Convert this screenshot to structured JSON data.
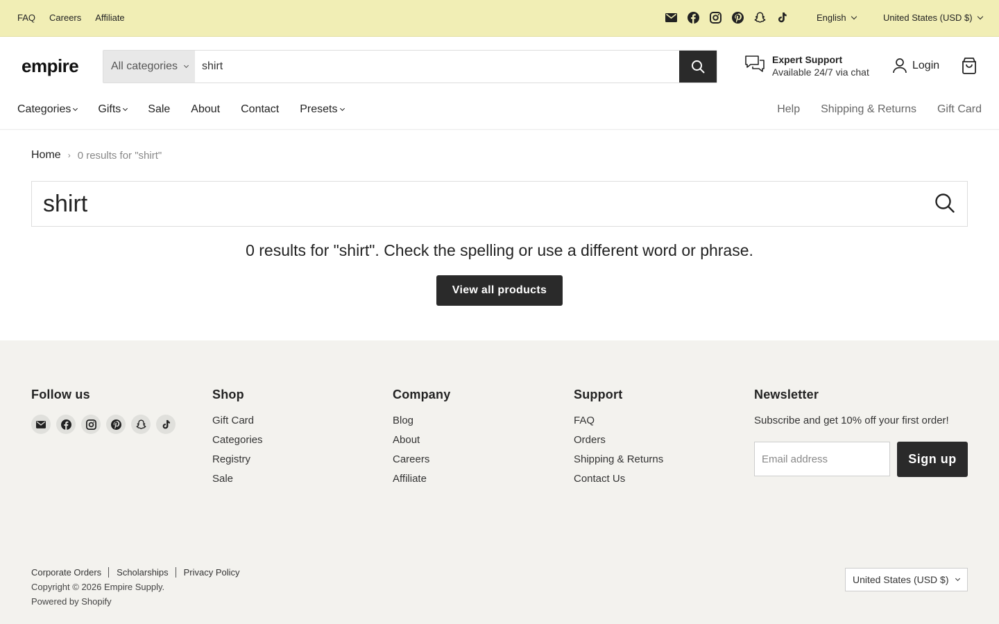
{
  "topbar": {
    "links": [
      "FAQ",
      "Careers",
      "Affiliate"
    ],
    "social_icons": [
      "email-icon",
      "facebook-icon",
      "instagram-icon",
      "pinterest-icon",
      "snapchat-icon",
      "tiktok-icon"
    ],
    "language": "English",
    "currency": "United States (USD $)"
  },
  "header": {
    "logo": "empire",
    "search": {
      "category": "All categories",
      "value": "shirt"
    },
    "support": {
      "title": "Expert Support",
      "subtitle": "Available 24/7 via chat"
    },
    "login_label": "Login"
  },
  "nav": {
    "left": [
      {
        "label": "Categories",
        "dropdown": true
      },
      {
        "label": "Gifts",
        "dropdown": true
      },
      {
        "label": "Sale",
        "dropdown": false
      },
      {
        "label": "About",
        "dropdown": false
      },
      {
        "label": "Contact",
        "dropdown": false
      },
      {
        "label": "Presets",
        "dropdown": true
      }
    ],
    "right": [
      "Help",
      "Shipping & Returns",
      "Gift Card"
    ]
  },
  "breadcrumb": {
    "home": "Home",
    "current": "0 results for \"shirt\""
  },
  "results": {
    "query": "shirt",
    "message": "0 results for \"shirt\". Check the spelling or use a different word or phrase.",
    "button": "View all products"
  },
  "footer": {
    "follow": {
      "title": "Follow us",
      "icons": [
        "email-icon",
        "facebook-icon",
        "instagram-icon",
        "pinterest-icon",
        "snapchat-icon",
        "tiktok-icon"
      ]
    },
    "shop": {
      "title": "Shop",
      "links": [
        "Gift Card",
        "Categories",
        "Registry",
        "Sale"
      ]
    },
    "company": {
      "title": "Company",
      "links": [
        "Blog",
        "About",
        "Careers",
        "Affiliate"
      ]
    },
    "support": {
      "title": "Support",
      "links": [
        "FAQ",
        "Orders",
        "Shipping & Returns",
        "Contact Us"
      ]
    },
    "newsletter": {
      "title": "Newsletter",
      "text": "Subscribe and get 10% off your first order!",
      "placeholder": "Email address",
      "button": "Sign up"
    },
    "legal": {
      "links": [
        "Corporate Orders",
        "Scholarships",
        "Privacy Policy"
      ],
      "copyright": "Copyright © 2026 Empire Supply.",
      "powered": "Powered by Shopify"
    },
    "currency": "United States (USD $)"
  }
}
